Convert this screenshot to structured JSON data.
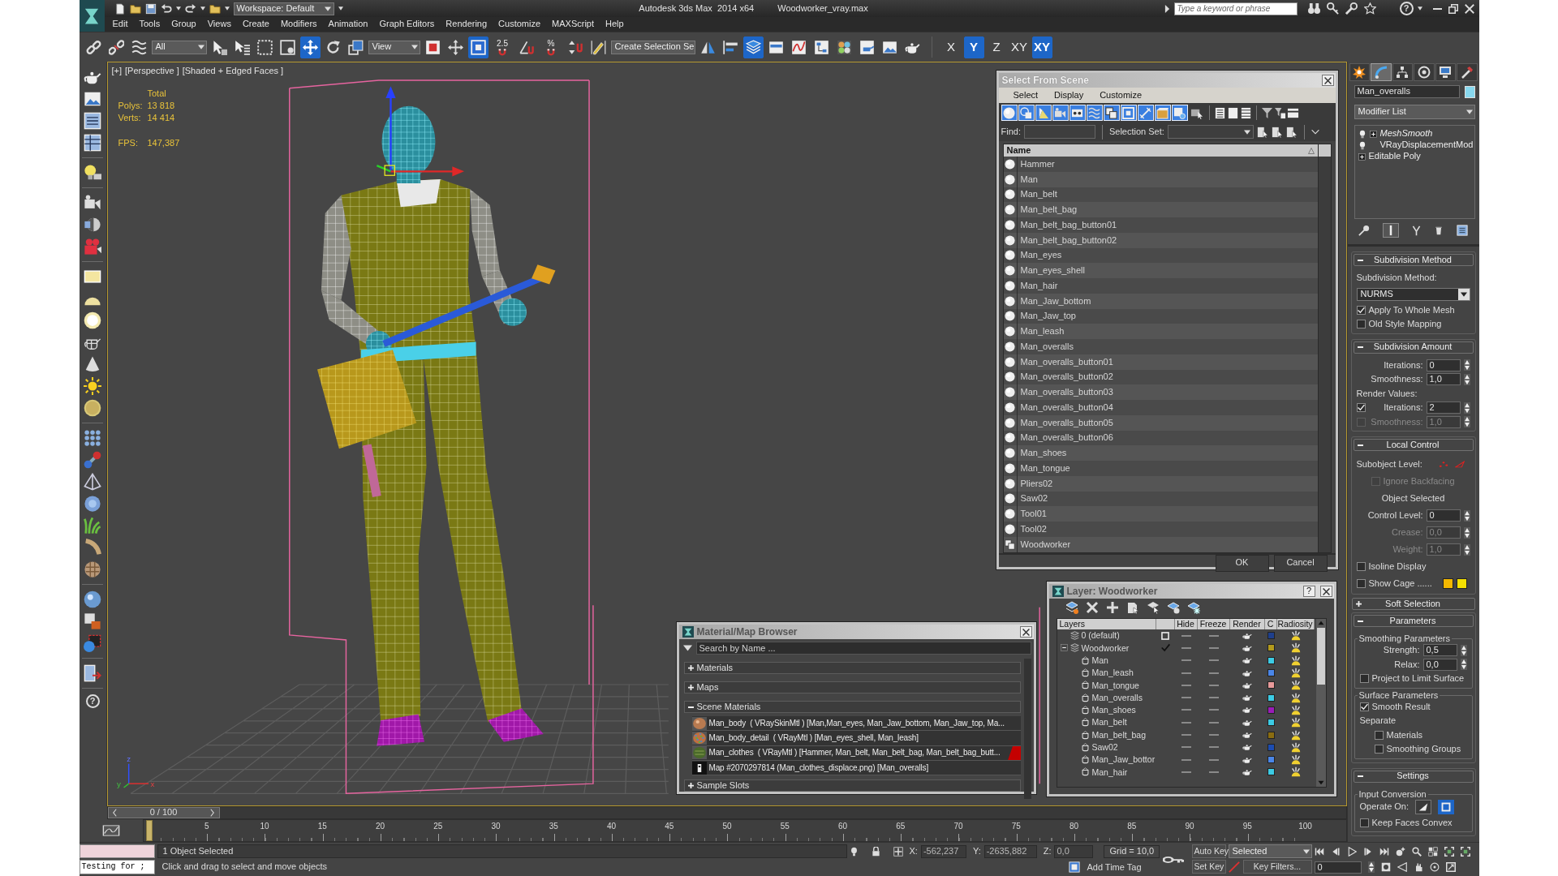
{
  "title_bar": {
    "workspace": "Workspace: Default",
    "app": "Autodesk 3ds Max  2014 x64",
    "file": "Woodworker_vray.max",
    "search": {
      "placeholder": "Type a keyword or phrase"
    },
    "help": "?"
  },
  "menu": [
    "Edit",
    "Tools",
    "Group",
    "Views",
    "Create",
    "Modifiers",
    "Animation",
    "Graph Editors",
    "Rendering",
    "Customize",
    "MAXScript",
    "Help"
  ],
  "main_toolbar": [
    {
      "kind": "link",
      "selected": false
    },
    {
      "kind": "unlink",
      "selected": false
    },
    {
      "kind": "bind",
      "selected": false
    },
    {
      "kind": "dropdown",
      "value": "All"
    },
    {
      "kind": "select",
      "selected": false
    },
    {
      "kind": "selectname",
      "selected": false
    },
    {
      "kind": "region",
      "selected": false
    },
    {
      "kind": "crossing",
      "selected": false
    },
    {
      "kind": "move",
      "selected": true
    },
    {
      "kind": "rotate",
      "selected": false
    },
    {
      "kind": "scale",
      "selected": false
    },
    {
      "kind": "dropdown",
      "value": "View"
    },
    {
      "kind": "pivot",
      "selected": false
    },
    {
      "kind": "manipulate",
      "selected": false
    },
    {
      "kind": "override",
      "selected": true
    },
    {
      "kind": "snap",
      "label": "2.5",
      "selected": false
    },
    {
      "kind": "anglesnap",
      "selected": false
    },
    {
      "kind": "percentsnap",
      "label": "%",
      "selected": false
    },
    {
      "kind": "spinnersnap",
      "selected": false
    },
    {
      "kind": "editsel",
      "selected": false
    },
    {
      "kind": "dropdown",
      "value": "Create Selection Se"
    },
    {
      "kind": "mirror",
      "selected": false
    },
    {
      "kind": "align",
      "selected": false
    },
    {
      "kind": "layers",
      "selected": true
    },
    {
      "kind": "ribbon",
      "selected": false
    },
    {
      "kind": "curves",
      "selected": false
    },
    {
      "kind": "schematic",
      "selected": false
    },
    {
      "kind": "material",
      "selected": false
    },
    {
      "kind": "rendersetup",
      "selected": false
    },
    {
      "kind": "framewindow",
      "selected": false
    },
    {
      "kind": "render",
      "selected": false
    }
  ],
  "axis_constraints": [
    {
      "label": "X",
      "selected": false
    },
    {
      "label": "Y",
      "selected": true
    },
    {
      "label": "Z",
      "selected": false
    },
    {
      "label": "XY",
      "selected": false
    },
    {
      "label": "XY",
      "selected": true
    }
  ],
  "left_toolbar": {
    "help": "?"
  },
  "viewport": {
    "labels": [
      "[+]",
      "[Perspective ]",
      "[Shaded + Edged Faces ]"
    ],
    "stats": {
      "heading": "Total",
      "rows": [
        {
          "label": "Polys:",
          "value": "13 818"
        },
        {
          "label": "Verts:",
          "value": "14 414"
        },
        {
          "label": "FPS:",
          "value": "147,387"
        }
      ]
    },
    "axes": [
      "z",
      "y",
      "x"
    ]
  },
  "select_from_scene": {
    "title": "Select From Scene",
    "menu": [
      "Select",
      "Display",
      "Customize"
    ],
    "filters": [
      {
        "kind": "geometry",
        "on": true
      },
      {
        "kind": "shapes",
        "on": true
      },
      {
        "kind": "lights",
        "on": true
      },
      {
        "kind": "cameras",
        "on": true
      },
      {
        "kind": "helpers",
        "on": true
      },
      {
        "kind": "warps",
        "on": true
      },
      {
        "kind": "groups",
        "on": true
      },
      {
        "kind": "xrefs",
        "on": true
      },
      {
        "kind": "bones",
        "on": true
      },
      {
        "kind": "containers",
        "on": true
      },
      {
        "kind": "frozen",
        "on": true
      },
      {
        "kind": "hidden",
        "on": false
      }
    ],
    "find": {
      "label": "Find:"
    },
    "selection_set": {
      "label": "Selection Set:"
    },
    "column": "Name",
    "items": [
      {
        "name": "Hammer",
        "kind": "object",
        "selected": false
      },
      {
        "name": "Man",
        "kind": "object",
        "selected": false
      },
      {
        "name": "Man_belt",
        "kind": "object",
        "selected": false
      },
      {
        "name": "Man_belt_bag",
        "kind": "object",
        "selected": false
      },
      {
        "name": "Man_belt_bag_button01",
        "kind": "object",
        "selected": false
      },
      {
        "name": "Man_belt_bag_button02",
        "kind": "object",
        "selected": false
      },
      {
        "name": "Man_eyes",
        "kind": "object",
        "selected": false
      },
      {
        "name": "Man_eyes_shell",
        "kind": "object",
        "selected": false
      },
      {
        "name": "Man_hair",
        "kind": "object",
        "selected": false
      },
      {
        "name": "Man_Jaw_bottom",
        "kind": "object",
        "selected": false
      },
      {
        "name": "Man_Jaw_top",
        "kind": "object",
        "selected": false
      },
      {
        "name": "Man_leash",
        "kind": "object",
        "selected": false
      },
      {
        "name": "Man_overalls",
        "kind": "object",
        "selected": false
      },
      {
        "name": "Man_overalls_button01",
        "kind": "object",
        "selected": false
      },
      {
        "name": "Man_overalls_button02",
        "kind": "object",
        "selected": false
      },
      {
        "name": "Man_overalls_button03",
        "kind": "object",
        "selected": false
      },
      {
        "name": "Man_overalls_button04",
        "kind": "object",
        "selected": false
      },
      {
        "name": "Man_overalls_button05",
        "kind": "object",
        "selected": false
      },
      {
        "name": "Man_overalls_button06",
        "kind": "object",
        "selected": false
      },
      {
        "name": "Man_shoes",
        "kind": "object",
        "selected": false
      },
      {
        "name": "Man_tongue",
        "kind": "object",
        "selected": false
      },
      {
        "name": "Pliers02",
        "kind": "object",
        "selected": false
      },
      {
        "name": "Saw02",
        "kind": "object",
        "selected": false
      },
      {
        "name": "Tool01",
        "kind": "object",
        "selected": false
      },
      {
        "name": "Tool02",
        "kind": "object",
        "selected": false
      },
      {
        "name": "Woodworker",
        "kind": "group",
        "selected": false
      }
    ],
    "buttons": [
      "OK",
      "Cancel"
    ]
  },
  "material_browser": {
    "title": "Material/Map Browser",
    "search": {
      "placeholder": "Search by Name ..."
    },
    "sections": [
      {
        "label": "Materials",
        "expanded": false
      },
      {
        "label": "Maps",
        "expanded": false
      },
      {
        "label": "Scene Materials",
        "expanded": true,
        "items": [
          {
            "label": "Man_body  ( VRaySkinMtl ) [Man,Man_eyes, Man_Jaw_bottom, Man_Jaw_top, Ma...",
            "kind": "skin",
            "marked": false
          },
          {
            "label": "Man_body_detail  ( VRayMtl ) [Man_eyes_shell, Man_leash]",
            "kind": "noise",
            "marked": false
          },
          {
            "label": "Man_clothes  ( VRayMtl ) [Hammer, Man_belt, Man_belt_bag, Man_belt_bag_butt...",
            "kind": "fabric",
            "marked": true
          },
          {
            "label": "Map #2070297814 (Man_clothes_displace.png) [Man_overalls]",
            "kind": "bitmap",
            "marked": false
          }
        ]
      },
      {
        "label": "Sample Slots",
        "expanded": false
      }
    ]
  },
  "layer_manager": {
    "title": "Layer: Woodworker",
    "help": "?",
    "columns": [
      "Layers",
      "Hide",
      "Freeze",
      "Render",
      "C",
      "Radiosity"
    ],
    "layers": [
      {
        "name": "0 (default)",
        "current": false,
        "hidden": false,
        "frozen": false,
        "color": "#1e3f8c"
      },
      {
        "name": "Woodworker",
        "current": true,
        "hidden": false,
        "frozen": false,
        "color": "#b39a1c",
        "expanded": true,
        "children": [
          {
            "name": "Man",
            "hidden": false,
            "frozen": false,
            "color": "#3ccbe4"
          },
          {
            "name": "Man_leash",
            "hidden": false,
            "frozen": false,
            "color": "#4a86e8"
          },
          {
            "name": "Man_tongue",
            "hidden": false,
            "frozen": false,
            "color": "#e89a9a"
          },
          {
            "name": "Man_overalls",
            "hidden": false,
            "frozen": false,
            "color": "#3ccbe4"
          },
          {
            "name": "Man_shoes",
            "hidden": false,
            "frozen": false,
            "color": "#9a1cb8"
          },
          {
            "name": "Man_belt",
            "hidden": false,
            "frozen": false,
            "color": "#3ccbe4"
          },
          {
            "name": "Man_belt_bag",
            "hidden": false,
            "frozen": false,
            "color": "#8a6c10"
          },
          {
            "name": "Saw02",
            "hidden": false,
            "frozen": false,
            "color": "#1c4cb0"
          },
          {
            "name": "Man_Jaw_bottor",
            "hidden": false,
            "frozen": false,
            "color": "#4a86e8"
          },
          {
            "name": "Man_hair",
            "hidden": false,
            "frozen": false,
            "color": "#3ccbe4"
          }
        ]
      }
    ]
  },
  "command_panel": {
    "tabs": [
      {
        "kind": "create",
        "selected": false
      },
      {
        "kind": "modify",
        "selected": true
      },
      {
        "kind": "hierarchy",
        "selected": false
      },
      {
        "kind": "motion",
        "selected": false
      },
      {
        "kind": "display",
        "selected": false
      },
      {
        "kind": "utilities",
        "selected": false
      }
    ],
    "object": {
      "name": "Man_overalls",
      "color": "#88d8ee"
    },
    "modifier_list": "Modifier List",
    "stack": [
      {
        "name": "MeshSmooth",
        "kind": "modifier",
        "expandable": true,
        "instanced": true
      },
      {
        "name": "VRayDisplacementMod",
        "kind": "modifier",
        "expandable": false,
        "instanced": false
      },
      {
        "name": "Editable Poly",
        "kind": "base",
        "expandable": true,
        "instanced": false
      }
    ],
    "rollouts": [
      {
        "title": "Subdivision Method",
        "expanded": true,
        "controls": [
          {
            "kind": "label",
            "text": "Subdivision Method:"
          },
          {
            "kind": "dropdown",
            "value": "NURMS"
          },
          {
            "kind": "checkbox",
            "label": "Apply To Whole Mesh",
            "checked": true,
            "disabled": false
          },
          {
            "kind": "checkbox",
            "label": "Old Style Mapping",
            "checked": false,
            "disabled": false
          }
        ]
      },
      {
        "title": "Subdivision Amount",
        "expanded": true,
        "controls": [
          {
            "kind": "spinner",
            "label": "Iterations:",
            "value": "0",
            "disabled": false
          },
          {
            "kind": "spinner",
            "label": "Smoothness:",
            "value": "1,0",
            "disabled": false
          },
          {
            "kind": "label",
            "text": "Render Values:"
          },
          {
            "kind": "checkspinner",
            "label": "Iterations:",
            "value": "2",
            "checked": true,
            "disabled": false
          },
          {
            "kind": "checkspinner",
            "label": "Smoothness:",
            "value": "1,0",
            "checked": false,
            "disabled": true
          }
        ]
      },
      {
        "title": "Local Control",
        "expanded": true,
        "controls": [
          {
            "kind": "subobject",
            "label": "Subobject Level:"
          },
          {
            "kind": "subcheck",
            "label": "Ignore Backfacing",
            "checked": false,
            "disabled": true
          },
          {
            "kind": "note",
            "text": "Object Selected"
          },
          {
            "kind": "spinner",
            "label": "Control Level:",
            "value": "0",
            "disabled": false
          },
          {
            "kind": "spinner",
            "label": "Crease:",
            "value": "0,0",
            "disabled": true
          },
          {
            "kind": "spinner",
            "label": "Weight:",
            "value": "1,0",
            "disabled": true
          },
          {
            "kind": "checkbox",
            "label": "Isoline Display",
            "checked": false,
            "disabled": false
          },
          {
            "kind": "cage",
            "label": "Show Cage ......",
            "checked": false,
            "disabled": false,
            "swatches": [
              {
                "color": "#f5b800"
              },
              {
                "color": "#f5e000"
              }
            ]
          }
        ]
      },
      {
        "title": "Soft Selection",
        "expanded": false
      },
      {
        "title": "Parameters",
        "expanded": true,
        "controls": [
          {
            "kind": "group",
            "title": "Smoothing Parameters",
            "controls": [
              {
                "kind": "spinner",
                "label": "Strength:",
                "value": "0,5",
                "disabled": false
              },
              {
                "kind": "spinner",
                "label": "Relax:",
                "value": "0,0",
                "disabled": false
              },
              {
                "kind": "checkbox",
                "label": "Project to Limit Surface",
                "checked": false,
                "disabled": false
              }
            ]
          },
          {
            "kind": "group",
            "title": "Surface Parameters",
            "controls": [
              {
                "kind": "checkbox",
                "label": "Smooth Result",
                "checked": true,
                "disabled": false
              },
              {
                "kind": "label",
                "text": "Separate"
              },
              {
                "kind": "subcheck",
                "label": "Materials",
                "checked": false,
                "disabled": false
              },
              {
                "kind": "subcheck",
                "label": "Smoothing Groups",
                "checked": false,
                "disabled": false
              }
            ]
          }
        ]
      },
      {
        "title": "Settings",
        "expanded": true,
        "controls": [
          {
            "kind": "group",
            "title": "Input Conversion",
            "controls": [
              {
                "kind": "operate",
                "label": "Operate On:",
                "options": [
                  {
                    "kind": "triangle",
                    "selected": false
                  },
                  {
                    "kind": "polygon",
                    "selected": true
                  }
                ]
              },
              {
                "kind": "checkbox",
                "label": "Keep Faces Convex",
                "checked": false,
                "disabled": false
              }
            ]
          }
        ]
      }
    ]
  },
  "timeline": {
    "slider": "0 / 100",
    "ticks": [
      "5",
      "10",
      "15",
      "20",
      "25",
      "30",
      "35",
      "40",
      "45",
      "50",
      "55",
      "60",
      "65",
      "70",
      "75",
      "80",
      "85",
      "90",
      "95",
      "100"
    ]
  },
  "status_bar": {
    "listener": "Testing for ;",
    "selection": "1 Object Selected",
    "prompt": "Click and drag to select and move objects",
    "coords": [
      {
        "label": "X:",
        "value": "-562,237"
      },
      {
        "label": "Y:",
        "value": "-2635,882"
      },
      {
        "label": "Z:",
        "value": "0,0"
      }
    ],
    "grid": "Grid = 10,0",
    "time_tag": "Add Time Tag",
    "auto_key": "Auto Key",
    "key_mode": "Selected",
    "set_key": "Set Key",
    "key_filters": "Key Filters...",
    "frame": "0"
  }
}
